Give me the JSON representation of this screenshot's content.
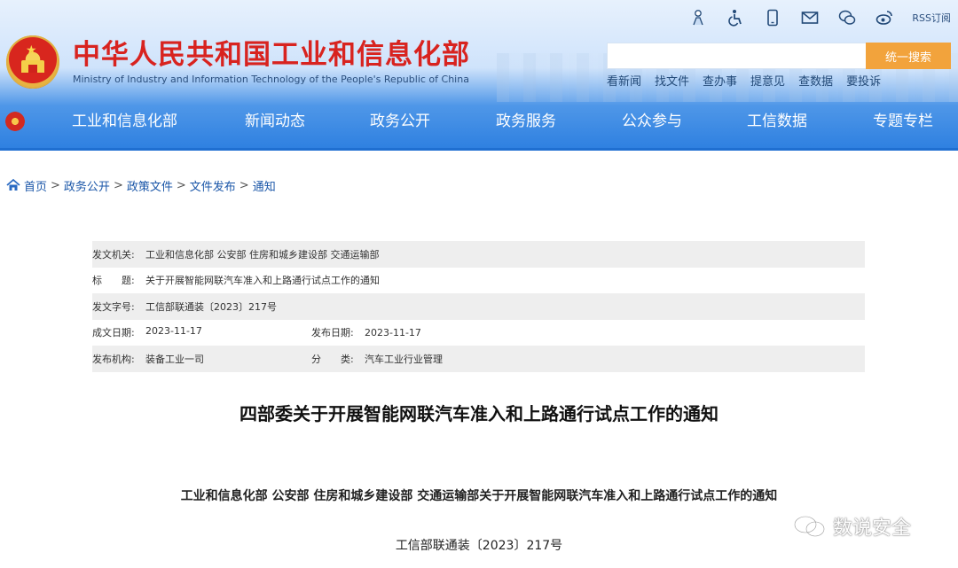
{
  "header": {
    "title": "中华人民共和国工业和信息化部",
    "subtitle": "Ministry of Industry and Information Technology of the People's Republic of China",
    "icons": [
      "elderly-mode-icon",
      "accessibility-icon",
      "mobile-icon",
      "mail-icon",
      "wechat-icon",
      "weibo-icon",
      "rss-icon"
    ],
    "rss_label": "RSS订阅",
    "search": {
      "placeholder": "",
      "button_label": "统一搜索"
    },
    "quick_links": [
      "看新闻",
      "找文件",
      "查办事",
      "提意见",
      "查数据",
      "要投诉"
    ],
    "nav": [
      "工业和信息化部",
      "新闻动态",
      "政务公开",
      "政务服务",
      "公众参与",
      "工信数据",
      "专题专栏"
    ]
  },
  "breadcrumb": {
    "items": [
      "首页",
      "政务公开",
      "政策文件",
      "文件发布",
      "通知"
    ],
    "separator": ">"
  },
  "meta": {
    "issuer_label": "发文机关:",
    "issuer": "工业和信息化部 公安部 住房和城乡建设部 交通运输部",
    "title_label": "标　　题:",
    "title": "关于开展智能网联汽车准入和上路通行试点工作的通知",
    "doc_no_label": "发文字号:",
    "doc_no": "工信部联通装〔2023〕217号",
    "written_label": "成文日期:",
    "written": "2023-11-17",
    "published_label": "发布日期:",
    "published": "2023-11-17",
    "agency_label": "发布机构:",
    "agency": "装备工业一司",
    "category_label": "分　　类:",
    "category": "汽车工业行业管理"
  },
  "document": {
    "title": "四部委关于开展智能网联汽车准入和上路通行试点工作的通知",
    "subtitle": "工业和信息化部 公安部 住房和城乡建设部 交通运输部关于开展智能网联汽车准入和上路通行试点工作的通知",
    "number": "工信部联通装〔2023〕217号"
  },
  "watermark": {
    "text": "数说安全"
  },
  "colors": {
    "brand_red": "#d8231f",
    "nav_blue": "#2d7fe0",
    "search_orange": "#f2a33c",
    "link_blue": "#1a56a8"
  }
}
